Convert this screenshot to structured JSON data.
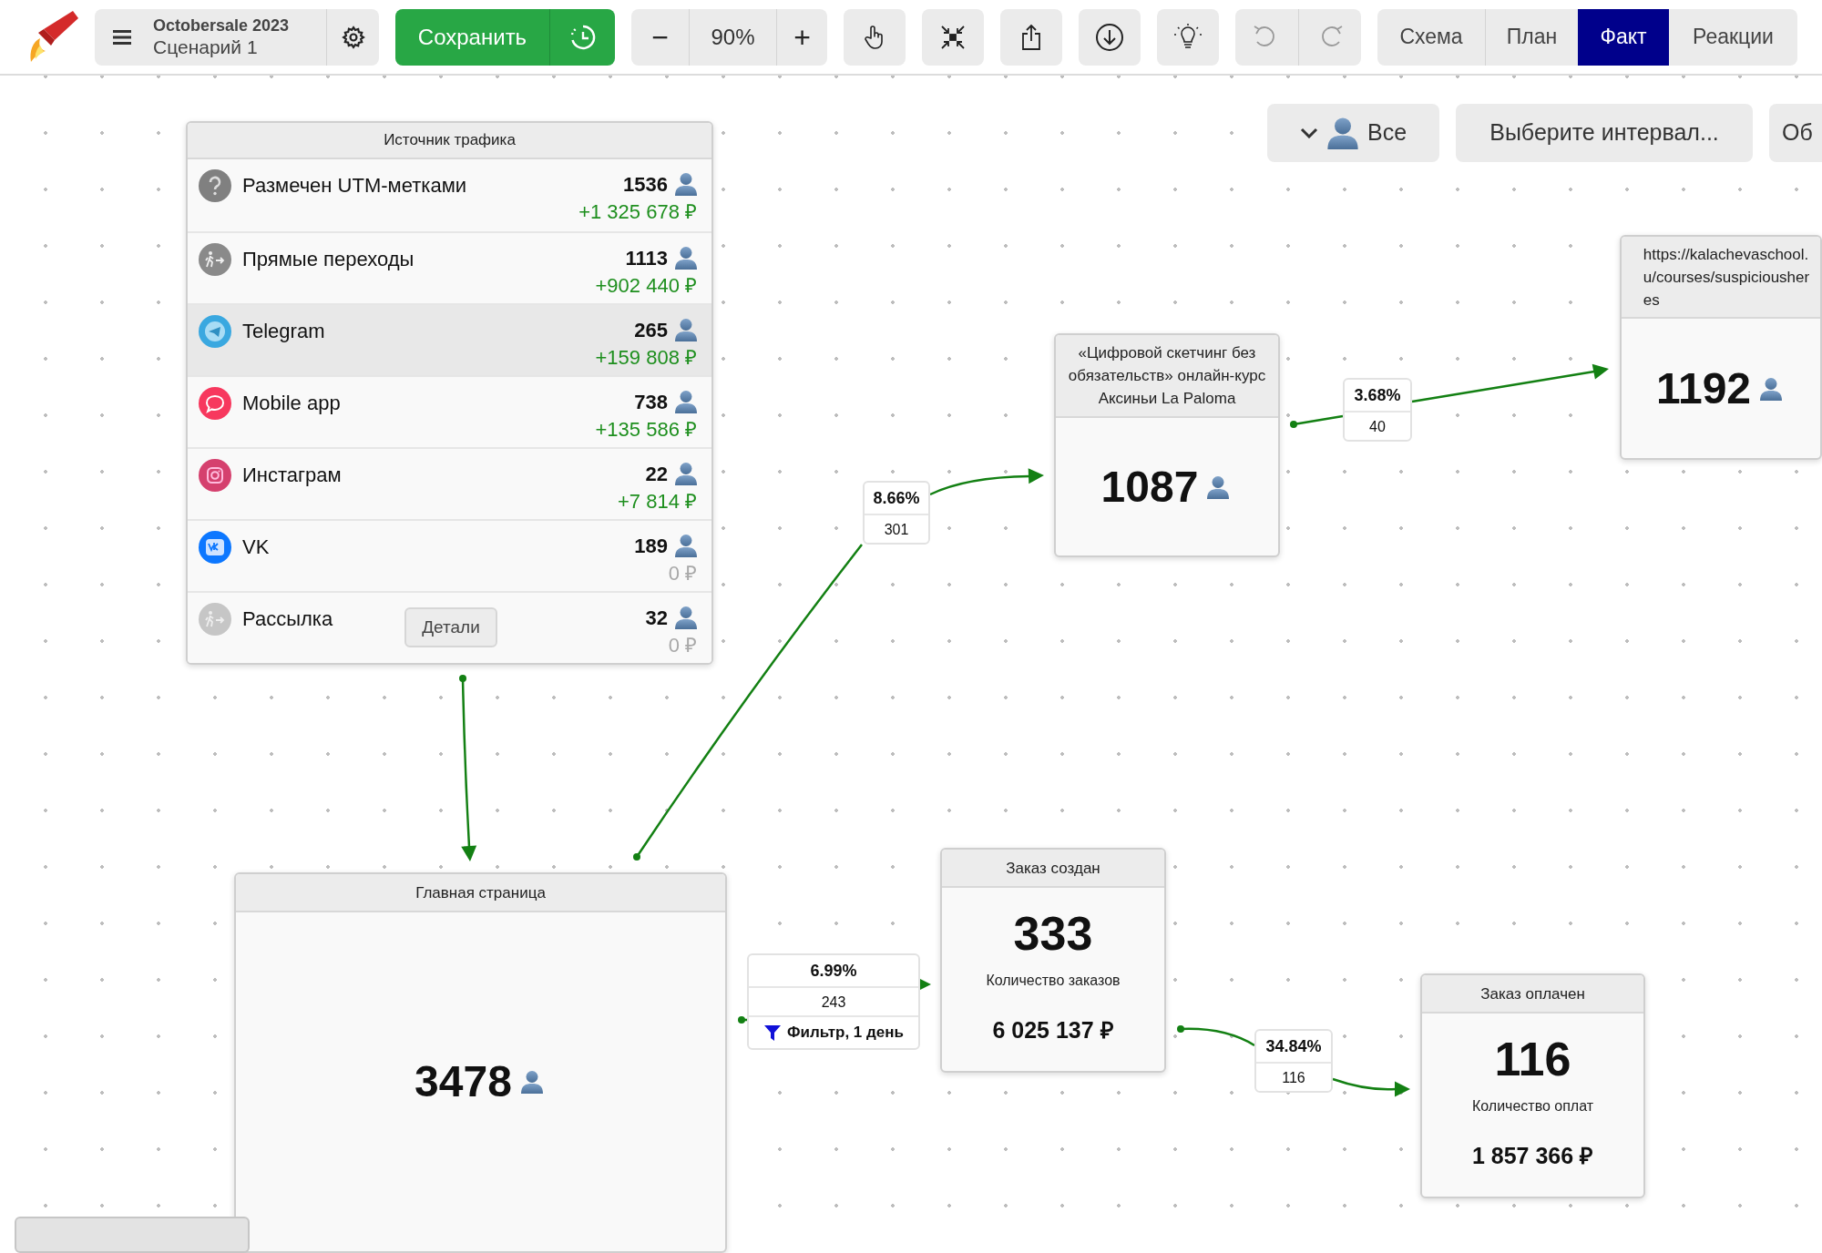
{
  "toolbar": {
    "project_title": "Octobersale 2023",
    "scenario": "Сценарий 1",
    "save_label": "Сохранить",
    "zoom_out": "−",
    "zoom": "90%",
    "zoom_in": "+",
    "history_buttons": [
      {
        "kind": "undo",
        "disabled": true
      },
      {
        "kind": "redo",
        "disabled": true
      }
    ],
    "view_tabs": [
      {
        "label": "Схема",
        "selected": false
      },
      {
        "label": "План",
        "selected": false
      },
      {
        "label": "Факт",
        "selected": true
      },
      {
        "label": "Реакции",
        "selected": false
      }
    ]
  },
  "filters": {
    "audience": "Все",
    "interval": "Выберите интервал...",
    "cut_button": "Об"
  },
  "traffic_source": {
    "title": "Источник трафика",
    "details_button": "Детали",
    "rows": [
      {
        "kind": "unknown",
        "name": "Размечен UTM-метками",
        "visitors": "1536",
        "revenue": "+1 325 678 ₽",
        "revenue_muted": false,
        "selected": false
      },
      {
        "kind": "direct",
        "name": "Прямые переходы",
        "visitors": "1113",
        "revenue": "+902 440 ₽",
        "revenue_muted": false,
        "selected": false
      },
      {
        "kind": "telegram",
        "name": "Telegram",
        "visitors": "265",
        "revenue": "+159 808 ₽",
        "revenue_muted": false,
        "selected": true
      },
      {
        "kind": "chat",
        "name": "Mobile app",
        "visitors": "738",
        "revenue": "+135 586 ₽",
        "revenue_muted": false,
        "selected": false
      },
      {
        "kind": "instagram",
        "name": "Инстаграм",
        "visitors": "22",
        "revenue": "+7 814 ₽",
        "revenue_muted": false,
        "selected": false
      },
      {
        "kind": "vk",
        "name": "VK",
        "visitors": "189",
        "revenue": "0 ₽",
        "revenue_muted": true,
        "selected": false
      },
      {
        "kind": "newsletter",
        "name": "Рассылка",
        "visitors": "32",
        "revenue": "0 ₽",
        "revenue_muted": true,
        "selected": false
      }
    ]
  },
  "nodes": [
    {
      "kind": "page",
      "title_lines": [
        "«Цифровой скетчинг без обязательств» онлайн-курс Аксиньи La Paloma"
      ],
      "visitors": "1087"
    },
    {
      "kind": "page",
      "title_lines": [
        "https://kalachevaschool.",
        "u/courses/suspiciousher",
        "es"
      ],
      "visitors": "1192"
    },
    {
      "kind": "page",
      "title_lines": [
        "Главная страница"
      ],
      "visitors": "3478"
    },
    {
      "kind": "metric",
      "title_lines": [
        "Заказ создан"
      ],
      "count": "333",
      "caption": "Количество заказов",
      "amount": "6 025 137 ₽"
    },
    {
      "kind": "metric",
      "title_lines": [
        "Заказ оплачен"
      ],
      "count": "116",
      "caption": "Количество оплат",
      "amount": "1 857 366 ₽"
    }
  ],
  "edges": [
    {
      "percent": "8.66%",
      "count": "301"
    },
    {
      "percent": "3.68%",
      "count": "40"
    },
    {
      "percent": "6.99%",
      "count": "243",
      "filter": "Фильтр, 1 день"
    },
    {
      "percent": "34.84%",
      "count": "116"
    }
  ]
}
